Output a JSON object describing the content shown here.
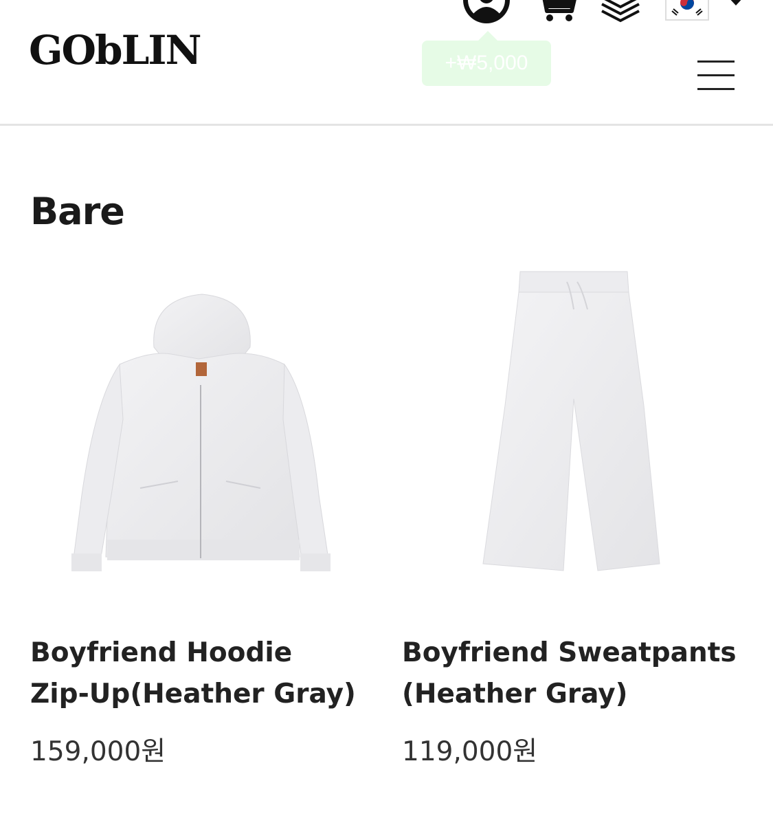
{
  "header": {
    "logo": "GObLIN",
    "tooltip": "+₩5,000",
    "icons": [
      "user-icon",
      "cart-icon",
      "layers-icon",
      "korea-flag-icon",
      "dropdown-arrow-icon",
      "menu-icon"
    ]
  },
  "section": {
    "title": "Bare"
  },
  "products": [
    {
      "name_line1": "Boyfriend Hoodie",
      "name_line2": "Zip-Up(Heather Gray)",
      "price": "159,000원"
    },
    {
      "name_line1": "Boyfriend Sweatpants",
      "name_line2": "(Heather Gray)",
      "price": "119,000원"
    }
  ],
  "colors": {
    "accent_tooltip": "#e6fbe6",
    "text": "#222222",
    "divider": "#e4e4e4"
  }
}
